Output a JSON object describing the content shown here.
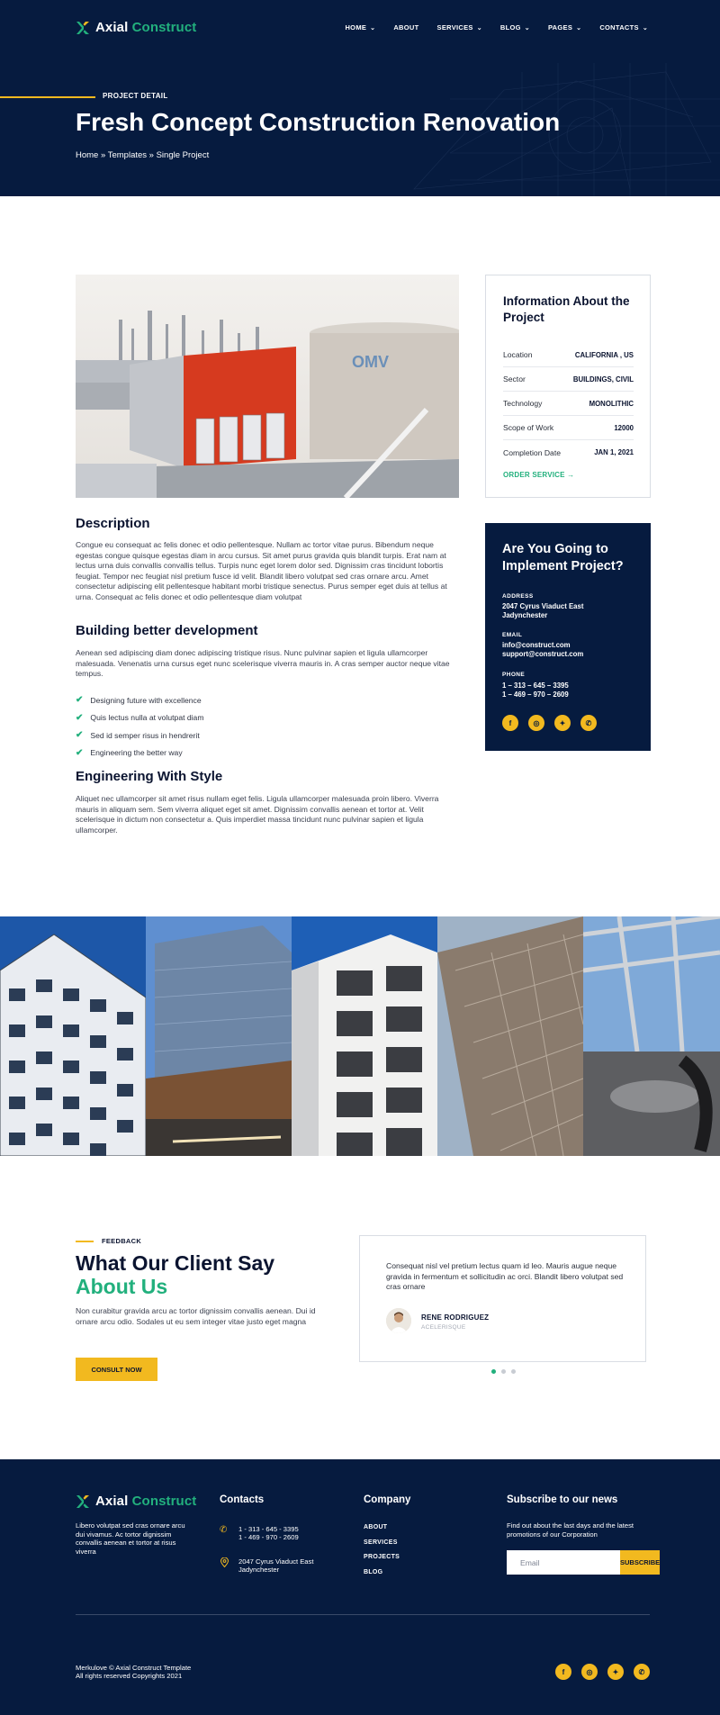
{
  "brand": {
    "name_part1": "Axial ",
    "name_part2": "Construct",
    "accent_color": "#22b07d",
    "primary_dark": "#061b3f",
    "highlight_color": "#f2b91f"
  },
  "nav": {
    "items": [
      {
        "label": "HOME",
        "has_dropdown": true
      },
      {
        "label": "ABOUT",
        "has_dropdown": false
      },
      {
        "label": "SERVICES",
        "has_dropdown": true
      },
      {
        "label": "BLOG",
        "has_dropdown": true
      },
      {
        "label": "PAGES",
        "has_dropdown": true
      },
      {
        "label": "CONTACTS",
        "has_dropdown": true
      }
    ]
  },
  "hero": {
    "eyebrow": "PROJECT DETAIL",
    "title": "Fresh Concept Construction Renovation",
    "breadcrumb": "Home » Templates » Single Project"
  },
  "content": {
    "description_heading": "Description",
    "description_text": "Congue eu consequat ac felis donec et odio pellentesque. Nullam ac tortor vitae purus. Bibendum neque egestas congue quisque egestas diam in arcu cursus. Sit amet purus gravida quis blandit turpis. Erat nam at lectus urna duis convallis convallis tellus. Turpis nunc eget lorem dolor sed. Dignissim cras tincidunt lobortis feugiat. Tempor nec feugiat nisl pretium fusce id velit. Blandit libero volutpat sed cras ornare arcu. Amet consectetur adipiscing elit pellentesque habitant morbi tristique senectus. Purus semper eget duis at tellus at urna. Consequat ac felis donec et odio pellentesque diam volutpat",
    "building_heading": "Building better development",
    "building_text": "Aenean sed adipiscing diam donec adipiscing tristique risus. Nunc pulvinar sapien et ligula ullamcorper malesuada. Venenatis urna cursus eget nunc scelerisque viverra mauris in. A cras semper auctor neque vitae tempus.",
    "checklist": [
      "Designing future with excellence",
      "Quis lectus nulla at volutpat diam",
      "Sed id semper risus in hendrerit",
      "Engineering the better way"
    ],
    "engineering_heading": "Engineering With Style",
    "engineering_text": "Aliquet nec ullamcorper sit amet risus nullam eget felis. Ligula ullamcorper malesuada proin libero. Viverra mauris in aliquam sem. Sem viverra aliquet eget sit amet. Dignissim convallis aenean et tortor at. Velit scelerisque in dictum non consectetur a. Quis imperdiet massa tincidunt nunc pulvinar sapien et ligula ullamcorper."
  },
  "info_card": {
    "title": "Information About the Project",
    "rows": [
      {
        "label": "Location",
        "value": "CALIFORNIA , US"
      },
      {
        "label": "Sector",
        "value": "BUILDINGS, CIVIL"
      },
      {
        "label": "Technology",
        "value": "MONOLITHIC"
      },
      {
        "label": "Scope of Work",
        "value": "12000"
      },
      {
        "label": "Completion Date",
        "value": "JAN 1, 2021"
      }
    ],
    "cta": "ORDER SERVICE →"
  },
  "contact_card": {
    "title": "Are You Going to Implement Project?",
    "address_label": "ADDRESS",
    "address_line1": "2047 Cyrus Viaduct East",
    "address_line2": "Jadynchester",
    "email_label": "EMAIL",
    "email_line1": "info@construct.com",
    "email_line2": "support@construct.com",
    "phone_label": "PHONE",
    "phone_line1": "1 – 313 – 645 – 3395",
    "phone_line2": "1 – 469 – 970 – 2609",
    "socials": [
      "facebook-icon",
      "instagram-icon",
      "twitter-icon",
      "whatsapp-icon"
    ]
  },
  "feedback": {
    "eyebrow": "FEEDBACK",
    "title_line1": "What Our Client Say",
    "title_line2": "About Us",
    "text": "Non curabitur gravida arcu ac tortor dignissim convallis aenean. Dui id ornare arcu odio. Sodales ut eu sem integer vitae justo eget magna",
    "button": "CONSULT NOW",
    "quote": "Consequat nisl vel pretium lectus quam id leo. Mauris augue neque gravida in fermentum et sollicitudin ac orci. Blandit libero volutpat sed cras ornare",
    "author_name": "RENE RODRIGUEZ",
    "author_role": "ACELERISQUE",
    "slides_total": 3,
    "active_slide": 1
  },
  "footer": {
    "about": "Libero volutpat sed cras ornare arcu dui vivamus. Ac tortor dignissim convallis aenean et tortor at risus viverra",
    "contacts_heading": "Contacts",
    "phone_line1": "1 - 313 - 645 - 3395",
    "phone_line2": "1 - 469 - 970 - 2609",
    "address_line1": "2047 Cyrus Viaduct East",
    "address_line2": "Jadynchester",
    "company_heading": "Company",
    "company_links": [
      "ABOUT",
      "SERVICES",
      "PROJECTS",
      "BLOG"
    ],
    "subscribe_heading": "Subscribe to our news",
    "subscribe_text": "Find out about the last days and the latest promotions of our Corporation",
    "email_placeholder": "Email",
    "subscribe_button": "SUBSCRIBE",
    "copyright_line1": "Merkulove © Axial Construct Template",
    "copyright_line2": "All rights reserved Copyrights 2021"
  }
}
